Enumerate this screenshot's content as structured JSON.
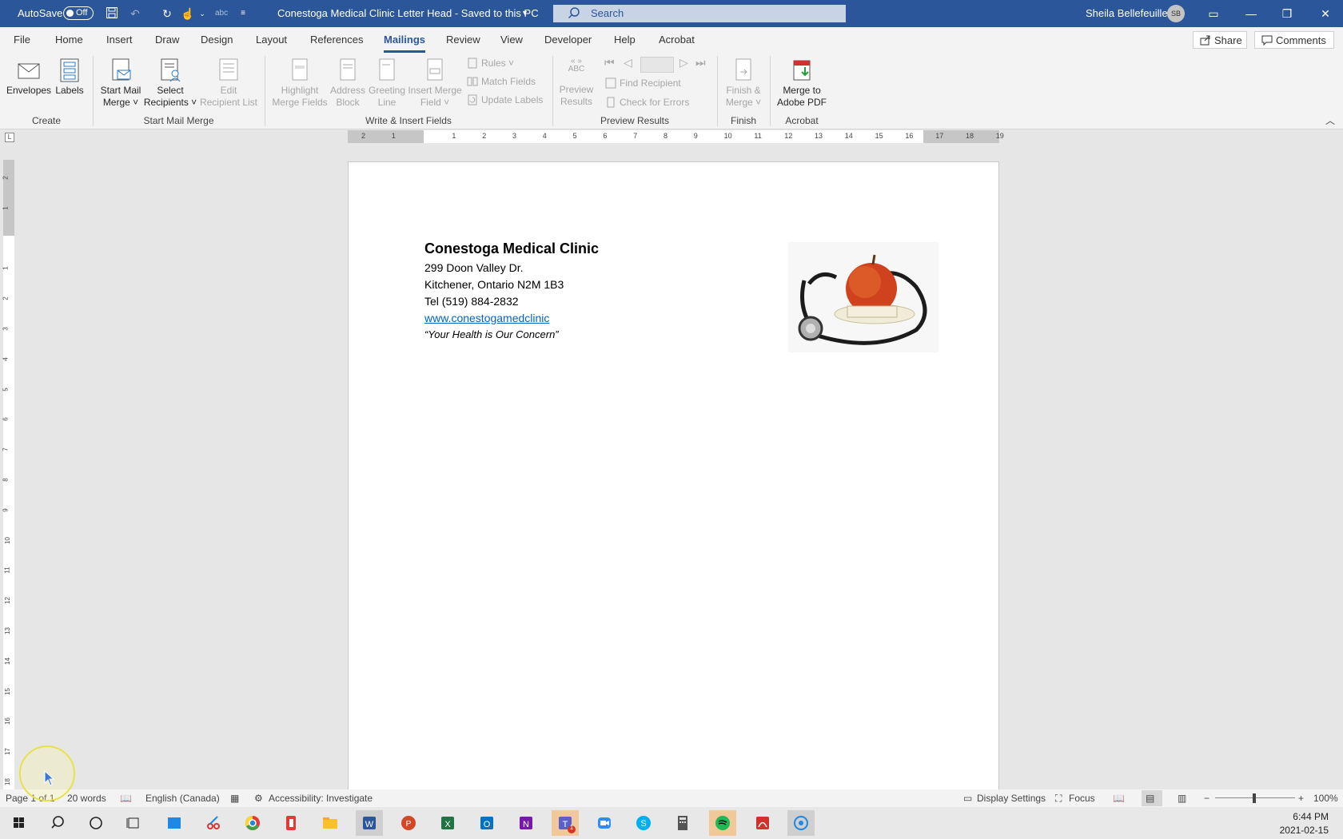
{
  "titlebar": {
    "autosave_label": "AutoSave",
    "autosave_state": "Off",
    "doc_title": "Conestoga Medical Clinic Letter Head  -  Saved to this PC",
    "search_placeholder": "Search",
    "user_name": "Sheila Bellefeuille",
    "user_initials": "SB",
    "accent": "#2b579a"
  },
  "tabs": {
    "file": "File",
    "home": "Home",
    "insert": "Insert",
    "draw": "Draw",
    "design": "Design",
    "layout": "Layout",
    "references": "References",
    "mailings": "Mailings",
    "review": "Review",
    "view": "View",
    "developer": "Developer",
    "help": "Help",
    "acrobat": "Acrobat",
    "share": "Share",
    "comments": "Comments"
  },
  "ribbon": {
    "create": {
      "envelopes": "Envelopes",
      "labels": "Labels",
      "group": "Create"
    },
    "start": {
      "start_mail_merge_1": "Start Mail",
      "start_mail_merge_2": "Merge",
      "select_1": "Select",
      "select_2": "Recipients",
      "edit_1": "Edit",
      "edit_2": "Recipient List",
      "group": "Start Mail Merge"
    },
    "write": {
      "highlight_1": "Highlight",
      "highlight_2": "Merge Fields",
      "address_1": "Address",
      "address_2": "Block",
      "greeting_1": "Greeting",
      "greeting_2": "Line",
      "insert_1": "Insert Merge",
      "insert_2": "Field",
      "rules": "Rules",
      "match": "Match Fields",
      "update": "Update Labels",
      "group": "Write & Insert Fields"
    },
    "preview": {
      "abc": "ABC",
      "preview_1": "Preview",
      "preview_2": "Results",
      "find": "Find Recipient",
      "check": "Check for Errors",
      "group": "Preview Results"
    },
    "finish": {
      "finish_1": "Finish &",
      "finish_2": "Merge",
      "group": "Finish"
    },
    "acrobat": {
      "merge_1": "Merge to",
      "merge_2": "Adobe PDF",
      "group": "Acrobat"
    }
  },
  "document": {
    "clinic_name": "Conestoga Medical Clinic",
    "address1": "299 Doon Valley Dr.",
    "address2": "Kitchener, Ontario N2M 1B3",
    "phone": "Tel (519) 884-2832",
    "website": "www.conestogamedclinic",
    "tagline": "“Your Health is Our Concern”"
  },
  "status": {
    "page": "Page 1 of 1",
    "words": "20 words",
    "language": "English (Canada)",
    "accessibility": "Accessibility: Investigate",
    "display": "Display Settings",
    "focus": "Focus",
    "zoom": "100%",
    "minus": "−",
    "plus": "+"
  },
  "taskbar": {
    "time": "6:44 PM",
    "date": "2021-02-15",
    "teams_badge": "1"
  }
}
